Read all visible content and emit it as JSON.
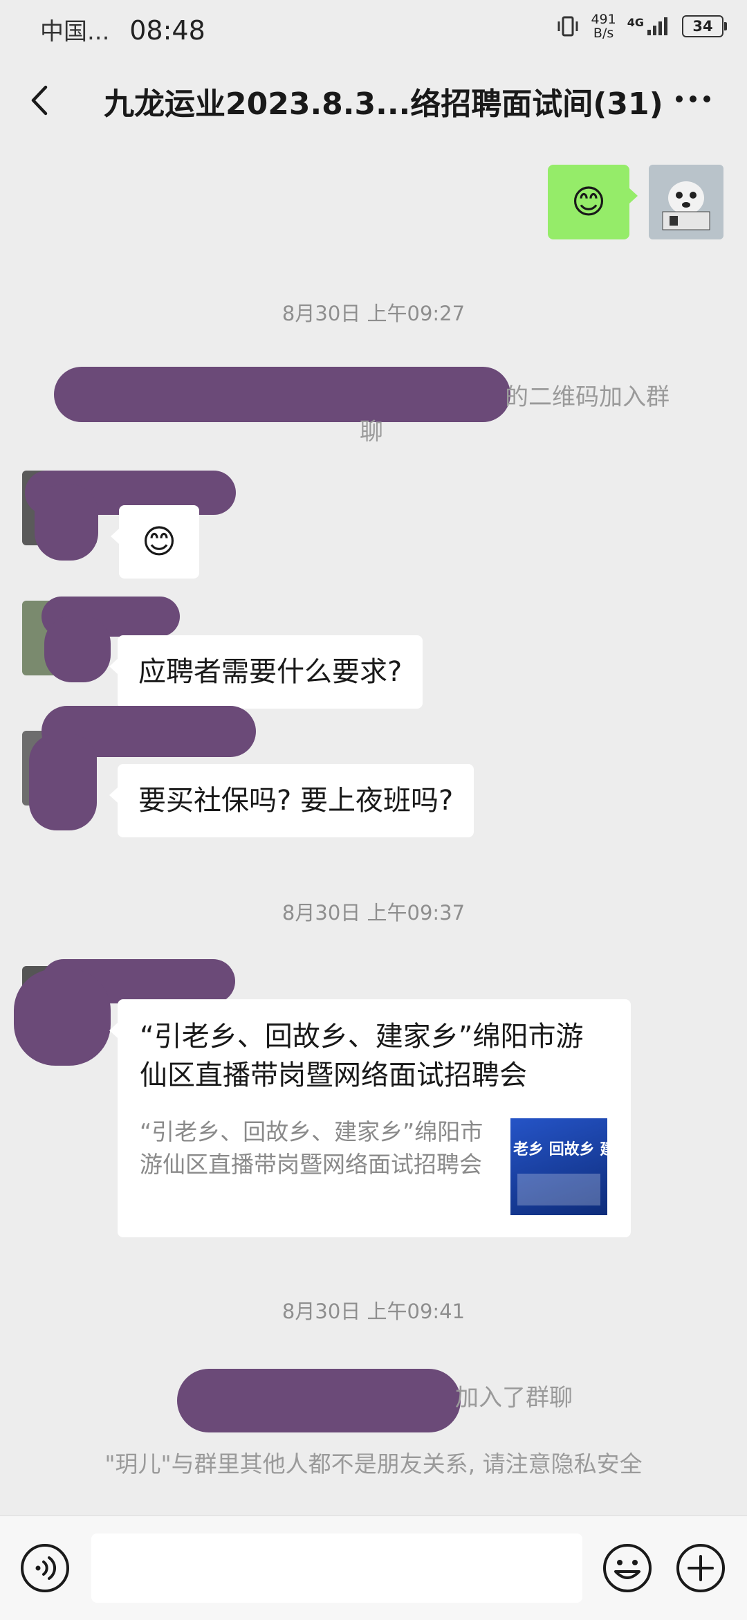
{
  "status_bar": {
    "carrier": "中国...",
    "time": "08:48",
    "net_speed": "491\nB/s",
    "signal": "4G",
    "battery": "34"
  },
  "header": {
    "title": "九龙运业2023.8.3...络招聘面试间(31)"
  },
  "messages": {
    "emoji": "😊",
    "ts1": "8月30日 上午09:27",
    "sys1_suffix": "的二维码加入群",
    "sys1_line2": "聊",
    "msg_q1": "应聘者需要什么要求?",
    "msg_q2": "要买社保吗? 要上夜班吗?",
    "ts2": "8月30日 上午09:37",
    "card": {
      "title": "“引老乡、回故乡、建家乡”绵阳市游仙区直播带岗暨网络面试招聘会",
      "desc": "“引老乡、回故乡、建家乡”绵阳市游仙区直播带岗暨网络面试招聘会",
      "thumb_text": "老乡 回故乡 建"
    },
    "ts3": "8月30日 上午09:41",
    "sys2_suffix": "加入了群聊",
    "sys3": "\"玥儿\"与群里其他人都不是朋友关系, 请注意隐私安全"
  },
  "input": {
    "placeholder": ""
  },
  "icons": {
    "back": "chevron-left-icon",
    "more": "more-dots-icon",
    "voice": "voice-icon",
    "emoji": "emoji-icon",
    "plus": "plus-icon"
  },
  "colors": {
    "background": "#ededed",
    "sent_bubble": "#95ec69",
    "received_bubble": "#ffffff",
    "scribble": "#6b4a78"
  }
}
